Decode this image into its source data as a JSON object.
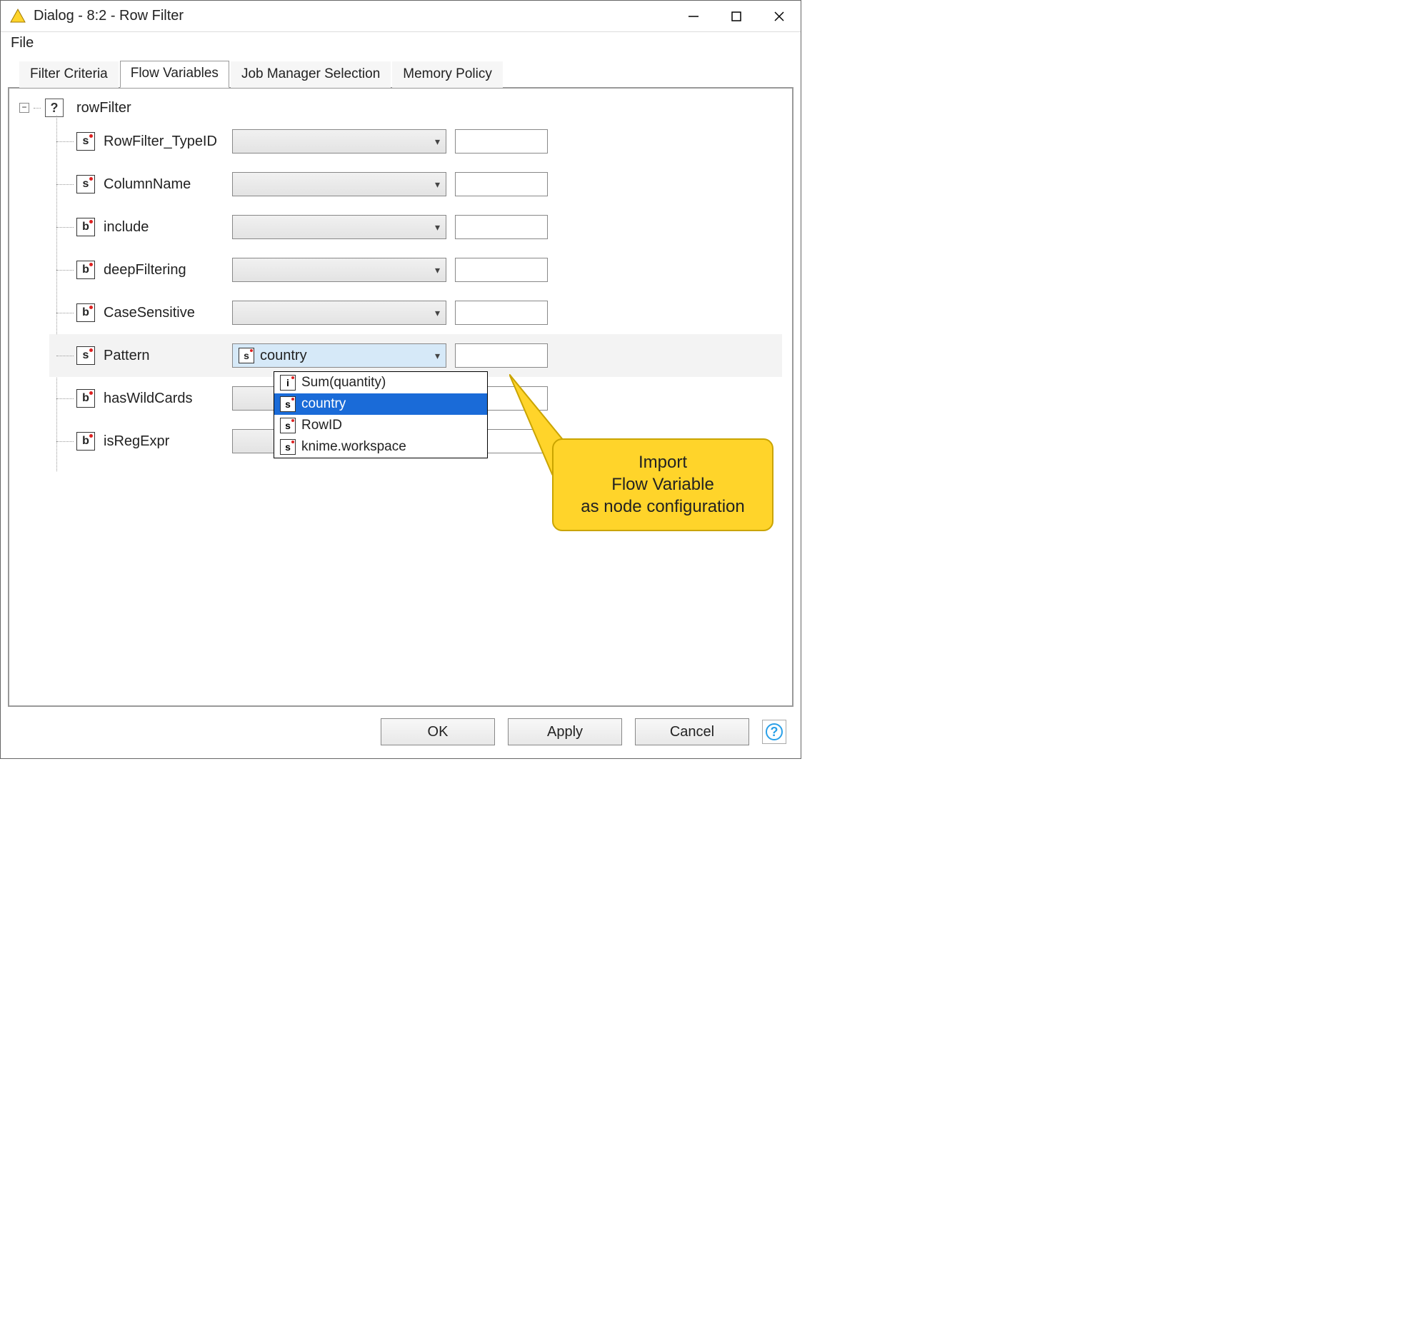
{
  "window": {
    "title": "Dialog - 8:2 - Row Filter"
  },
  "menubar": {
    "file": "File"
  },
  "tabs": {
    "items": [
      {
        "label": "Filter Criteria"
      },
      {
        "label": "Flow Variables"
      },
      {
        "label": "Job Manager Selection"
      },
      {
        "label": "Memory Policy"
      }
    ],
    "active_index": 1
  },
  "tree": {
    "root_label": "rowFilter",
    "rows": [
      {
        "type": "s",
        "name": "RowFilter_TypeID",
        "selected": "",
        "value": ""
      },
      {
        "type": "s",
        "name": "ColumnName",
        "selected": "",
        "value": ""
      },
      {
        "type": "b",
        "name": "include",
        "selected": "",
        "value": ""
      },
      {
        "type": "b",
        "name": "deepFiltering",
        "selected": "",
        "value": ""
      },
      {
        "type": "b",
        "name": "CaseSensitive",
        "selected": "",
        "value": ""
      },
      {
        "type": "s",
        "name": "Pattern",
        "selected": "country",
        "value": "",
        "highlight": true,
        "show_badge": true
      },
      {
        "type": "b",
        "name": "hasWildCards",
        "selected": "",
        "value": ""
      },
      {
        "type": "b",
        "name": "isRegExpr",
        "selected": "",
        "value": ""
      }
    ]
  },
  "dropdown": {
    "items": [
      {
        "type": "i",
        "label": "Sum(quantity)"
      },
      {
        "type": "s",
        "label": "country",
        "selected": true
      },
      {
        "type": "s",
        "label": "RowID"
      },
      {
        "type": "s",
        "label": "knime.workspace"
      }
    ]
  },
  "callout": {
    "line1": "Import",
    "line2": "Flow Variable",
    "line3": "as node configuration"
  },
  "buttons": {
    "ok": "OK",
    "apply": "Apply",
    "cancel": "Cancel"
  }
}
